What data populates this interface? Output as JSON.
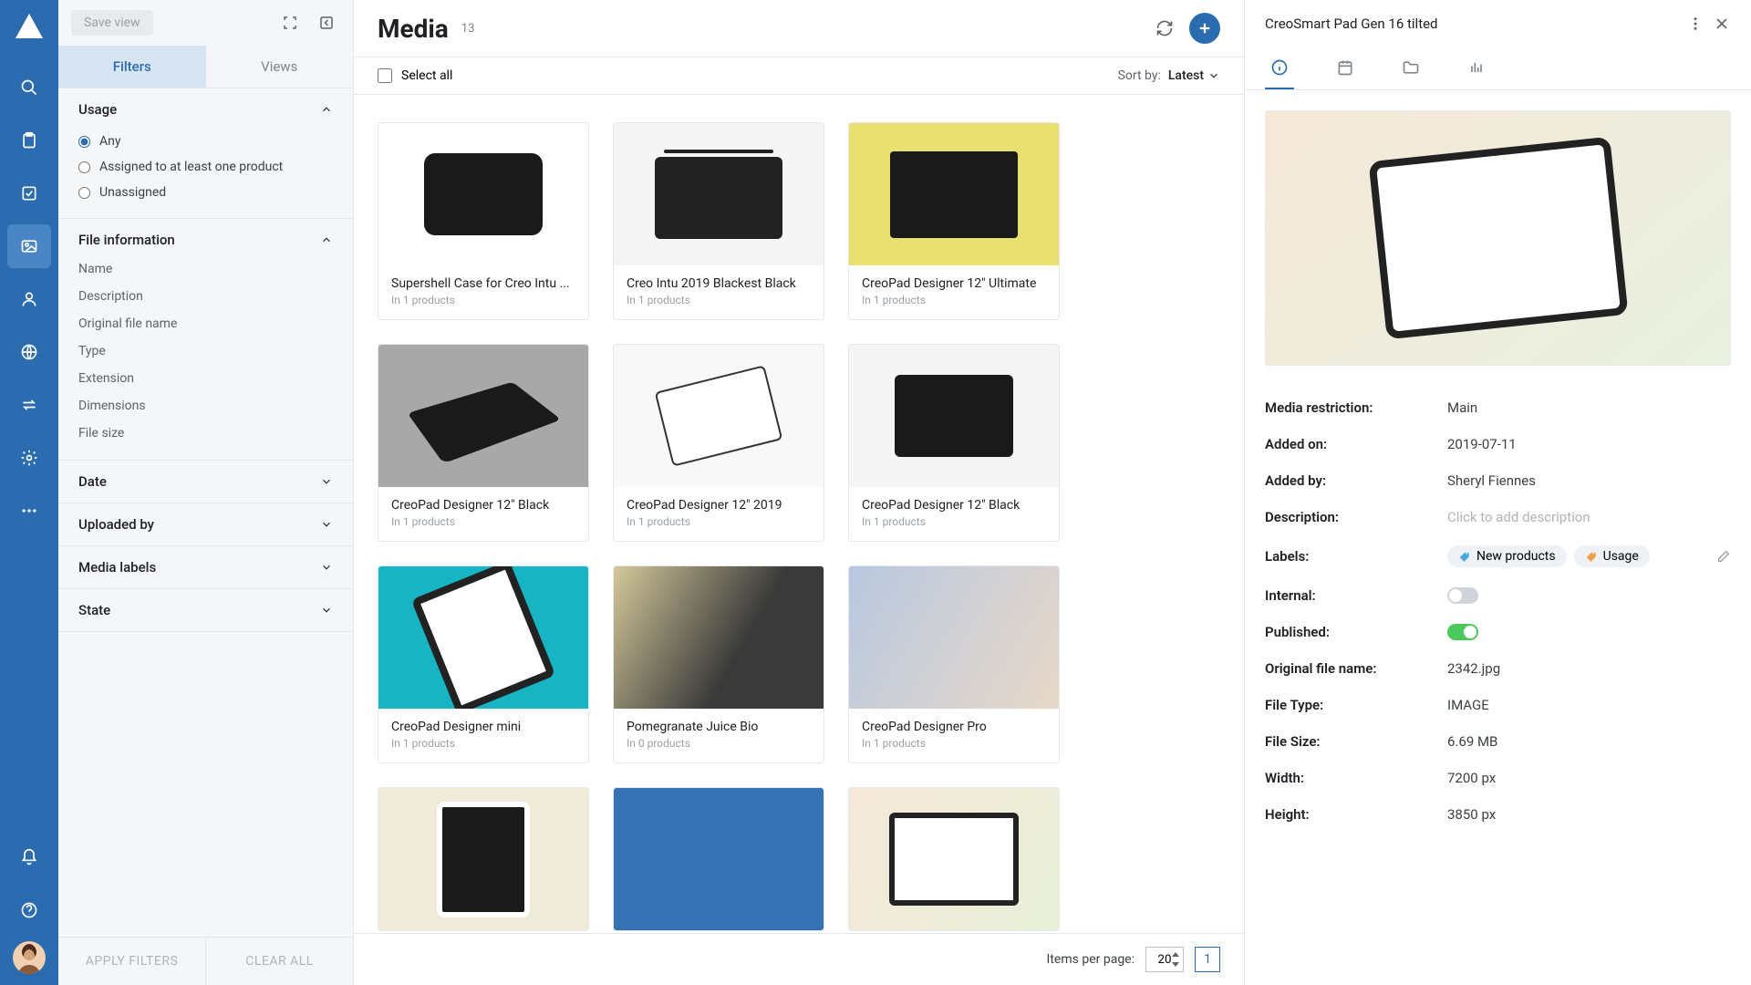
{
  "header": {
    "save_view": "Save view",
    "page_title": "Media",
    "count": "13"
  },
  "filter_tabs": {
    "filters": "Filters",
    "views": "Views"
  },
  "filters": {
    "usage": {
      "title": "Usage",
      "options": {
        "any": "Any",
        "assigned": "Assigned to at least one product",
        "unassigned": "Unassigned"
      }
    },
    "file_info": {
      "title": "File information",
      "items": [
        "Name",
        "Description",
        "Original file name",
        "Type",
        "Extension",
        "Dimensions",
        "File size"
      ]
    },
    "date": "Date",
    "uploaded_by": "Uploaded by",
    "media_labels": "Media labels",
    "state": "State",
    "apply": "APPLY FILTERS",
    "clear": "CLEAR ALL"
  },
  "toolbar": {
    "select_all": "Select all",
    "sort_by": "Sort by:",
    "sort_value": "Latest"
  },
  "cards": [
    {
      "title": "Supershell Case for Creo Intu ...",
      "sub": "In 1 products"
    },
    {
      "title": "Creo Intu 2019 Blackest Black",
      "sub": "In 1 products"
    },
    {
      "title": "CreoPad Designer 12\" Ultimate",
      "sub": "In 1 products"
    },
    {
      "title": "CreoPad Designer 12\" Black",
      "sub": "In 1 products"
    },
    {
      "title": "CreoPad Designer 12\" 2019",
      "sub": "In 1 products"
    },
    {
      "title": "CreoPad Designer 12\" Black",
      "sub": "In 1 products"
    },
    {
      "title": "CreoPad Designer mini",
      "sub": "In 1 products"
    },
    {
      "title": "Pomegranate Juice Bio",
      "sub": "In 0 products"
    },
    {
      "title": "CreoPad Designer Pro",
      "sub": "In 1 products"
    }
  ],
  "pagination": {
    "label": "Items per page:",
    "per_page": "20",
    "page": "1"
  },
  "details": {
    "title": "CreoSmart Pad Gen 16 tilted",
    "props": {
      "restriction": {
        "label": "Media restriction:",
        "value": "Main"
      },
      "added_on": {
        "label": "Added on:",
        "value": "2019-07-11"
      },
      "added_by": {
        "label": "Added by:",
        "value": "Sheryl Fiennes"
      },
      "description": {
        "label": "Description:",
        "placeholder": "Click to add description"
      },
      "labels": {
        "label": "Labels:",
        "tag1": "New products",
        "tag2": "Usage"
      },
      "internal": {
        "label": "Internal:"
      },
      "published": {
        "label": "Published:"
      },
      "ofn": {
        "label": "Original file name:",
        "value": "2342.jpg"
      },
      "ftype": {
        "label": "File Type:",
        "value": "IMAGE"
      },
      "fsize": {
        "label": "File Size:",
        "value": "6.69 MB"
      },
      "width": {
        "label": "Width:",
        "value": "7200 px"
      },
      "height": {
        "label": "Height:",
        "value": "3850 px"
      }
    }
  }
}
